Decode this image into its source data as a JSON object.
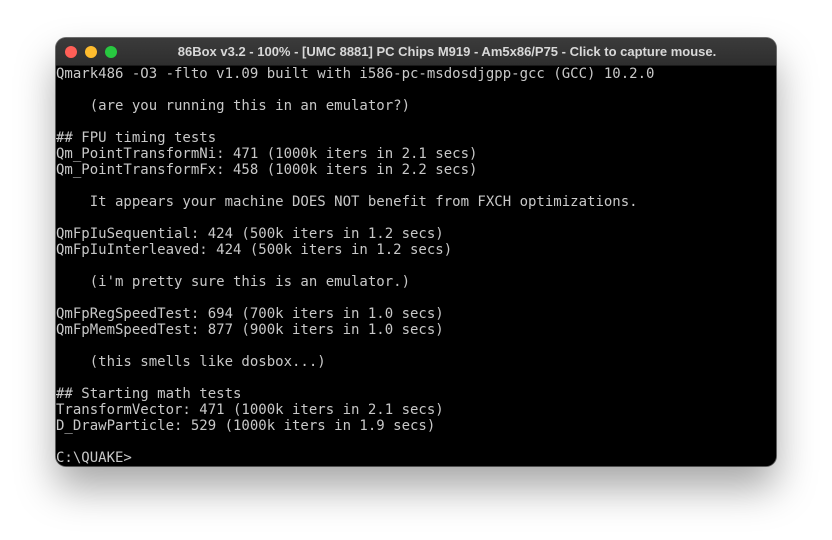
{
  "window": {
    "title": "86Box v3.2 - 100% - [UMC 8881] PC Chips M919 - Am5x86/P75 - Click to capture mouse."
  },
  "colors": {
    "close": "#ff5f57",
    "minimize": "#febc2e",
    "maximize": "#28c840",
    "terminal_bg": "#000000",
    "terminal_fg": "#c8c8c8"
  },
  "terminal": {
    "lines": [
      "Qmark486 -O3 -flto v1.09 built with i586-pc-msdosdjgpp-gcc (GCC) 10.2.0",
      "",
      "    (are you running this in an emulator?)",
      "",
      "## FPU timing tests",
      "Qm_PointTransformNi: 471 (1000k iters in 2.1 secs)",
      "Qm_PointTransformFx: 458 (1000k iters in 2.2 secs)",
      "",
      "    It appears your machine DOES NOT benefit from FXCH optimizations.",
      "",
      "QmFpIuSequential: 424 (500k iters in 1.2 secs)",
      "QmFpIuInterleaved: 424 (500k iters in 1.2 secs)",
      "",
      "    (i'm pretty sure this is an emulator.)",
      "",
      "QmFpRegSpeedTest: 694 (700k iters in 1.0 secs)",
      "QmFpMemSpeedTest: 877 (900k iters in 1.0 secs)",
      "",
      "    (this smells like dosbox...)",
      "",
      "## Starting math tests",
      "TransformVector: 471 (1000k iters in 2.1 secs)",
      "D_DrawParticle: 529 (1000k iters in 1.9 secs)",
      "",
      "C:\\QUAKE>"
    ]
  }
}
